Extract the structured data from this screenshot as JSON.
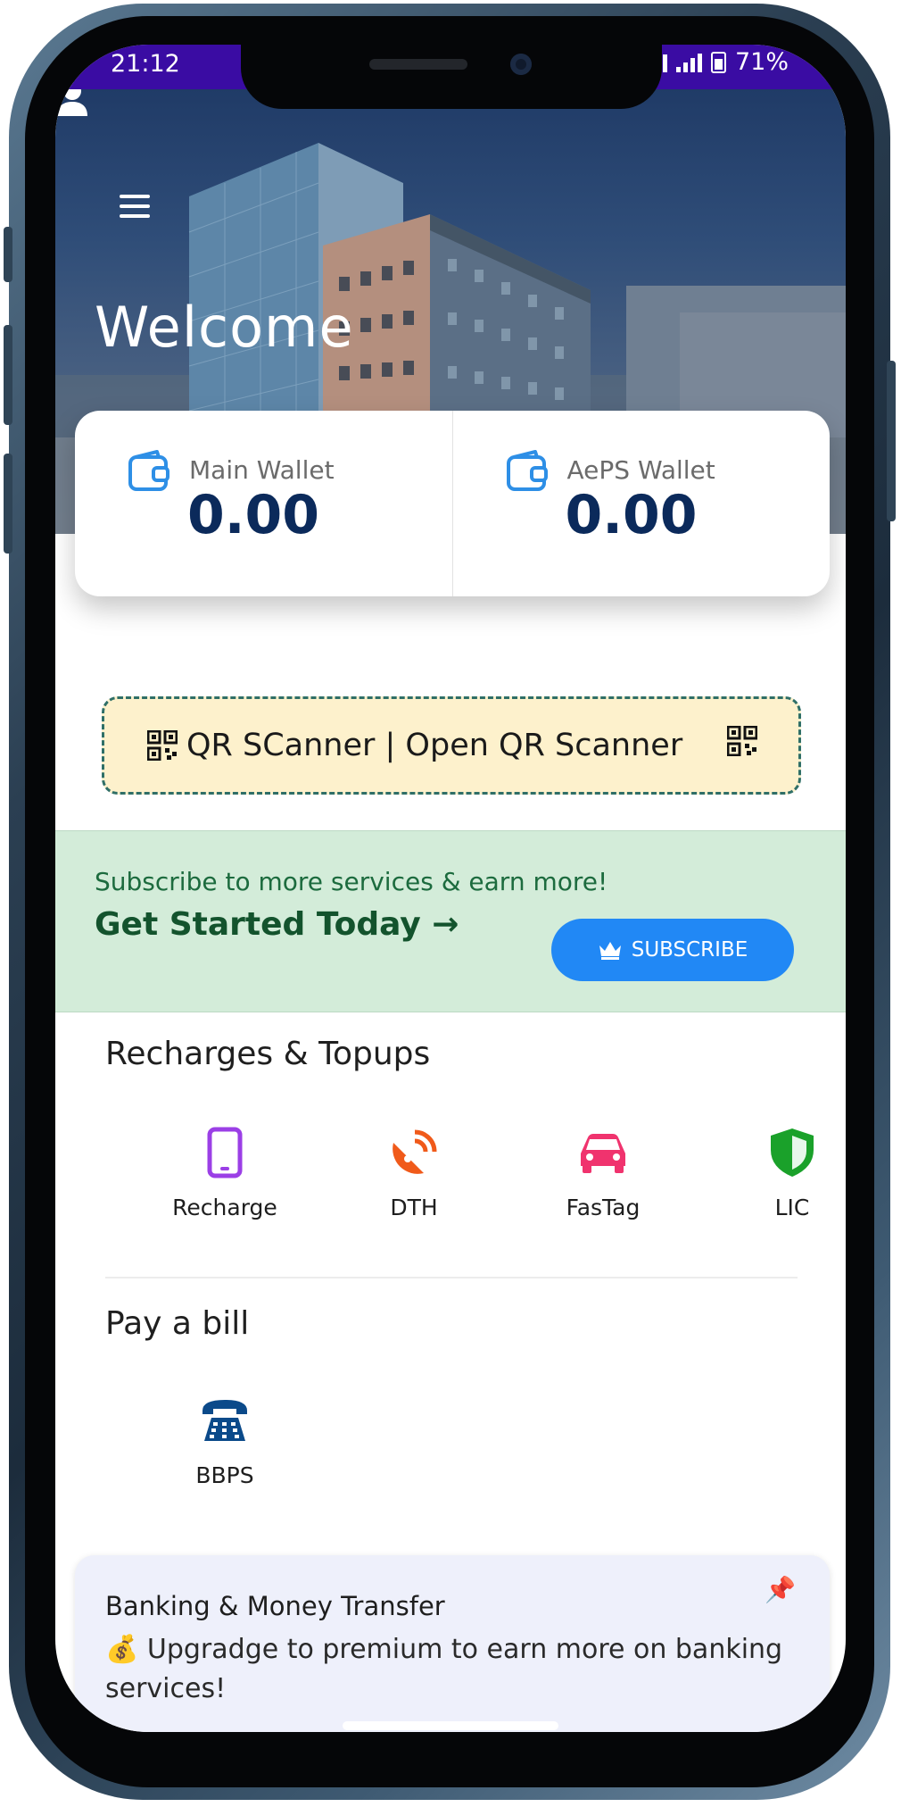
{
  "status_bar": {
    "time": "21:12",
    "battery": "71%"
  },
  "header": {
    "welcome": "Welcome",
    "menu_icon": "hamburger-menu-icon",
    "profile_icon": "user-icon"
  },
  "wallets": [
    {
      "label": "Main Wallet",
      "value": "0.00",
      "icon": "wallet-icon"
    },
    {
      "label": "AePS Wallet",
      "value": "0.00",
      "icon": "wallet-icon"
    }
  ],
  "qr_scanner": {
    "label": "QR SCanner | Open QR Scanner",
    "icon": "qr-code-icon"
  },
  "subscribe": {
    "tagline": "Subscribe to more services & earn more!",
    "cta": "Get Started Today →",
    "button_label": "SUBSCRIBE",
    "button_icon": "crown-icon"
  },
  "recharges": {
    "title": "Recharges & Topups",
    "items": [
      {
        "label": "Recharge",
        "icon": "mobile-phone-icon",
        "color": "#9b3fe6"
      },
      {
        "label": "DTH",
        "icon": "satellite-dish-icon",
        "color": "#f05a1a"
      },
      {
        "label": "FasTag",
        "icon": "car-icon",
        "color": "#f0336e"
      },
      {
        "label": "LIC",
        "icon": "shield-icon",
        "color": "#1aa12a"
      }
    ]
  },
  "bills": {
    "title": "Pay a bill",
    "items": [
      {
        "label": "BBPS",
        "icon": "telephone-icon",
        "color": "#0b4a8a"
      }
    ]
  },
  "banking": {
    "title": "Banking & Money Transfer",
    "message": "💰 Upgradge to premium to earn more on banking services!",
    "pin_icon": "pushpin-icon"
  },
  "colors": {
    "status_bar": "#3a0ca3",
    "wallet_value": "#0b2a5b",
    "subscribe_button": "#2188f5",
    "subscribe_banner": "#d3ecd9",
    "qr_bar": "#fdf1cc"
  }
}
